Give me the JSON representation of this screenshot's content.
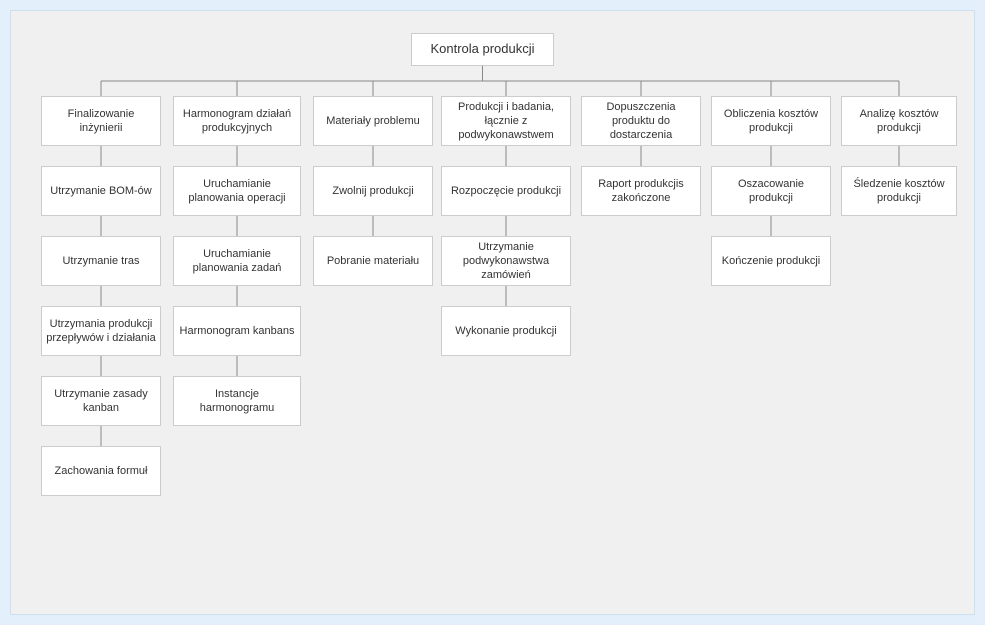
{
  "root": {
    "label": "Kontrola produkcji"
  },
  "columns": [
    {
      "head": {
        "label": "Finalizowanie inżynierii"
      },
      "items": [
        {
          "label": "Utrzymanie BOM-ów"
        },
        {
          "label": "Utrzymanie tras"
        },
        {
          "label": "Utrzymania produkcji przepływów i działania"
        },
        {
          "label": "Utrzymanie zasady kanban"
        },
        {
          "label": "Zachowania formuł"
        }
      ]
    },
    {
      "head": {
        "label": "Harmonogram działań produkcyjnych"
      },
      "items": [
        {
          "label": "Uruchamianie planowania operacji"
        },
        {
          "label": "Uruchamianie planowania zadań"
        },
        {
          "label": "Harmonogram kanbans"
        },
        {
          "label": "Instancje harmonogramu"
        }
      ]
    },
    {
      "head": {
        "label": "Materiały problemu"
      },
      "items": [
        {
          "label": "Zwolnij produkcji"
        },
        {
          "label": "Pobranie materiału"
        }
      ]
    },
    {
      "head": {
        "label": "Produkcji i badania, łącznie z podwykonawstwem"
      },
      "items": [
        {
          "label": "Rozpoczęcie produkcji"
        },
        {
          "label": "Utrzymanie podwykonawstwa zamówień"
        },
        {
          "label": "Wykonanie produkcji"
        }
      ]
    },
    {
      "head": {
        "label": "Dopuszczenia produktu do dostarczenia"
      },
      "items": [
        {
          "label": "Raport produkcjis zakończone"
        }
      ]
    },
    {
      "head": {
        "label": "Obliczenia kosztów produkcji"
      },
      "items": [
        {
          "label": "Oszacowanie produkcji"
        },
        {
          "label": "Kończenie produkcji"
        }
      ]
    },
    {
      "head": {
        "label": "Analizę kosztów produkcji"
      },
      "items": [
        {
          "label": "Śledzenie kosztów produkcji"
        }
      ]
    }
  ]
}
